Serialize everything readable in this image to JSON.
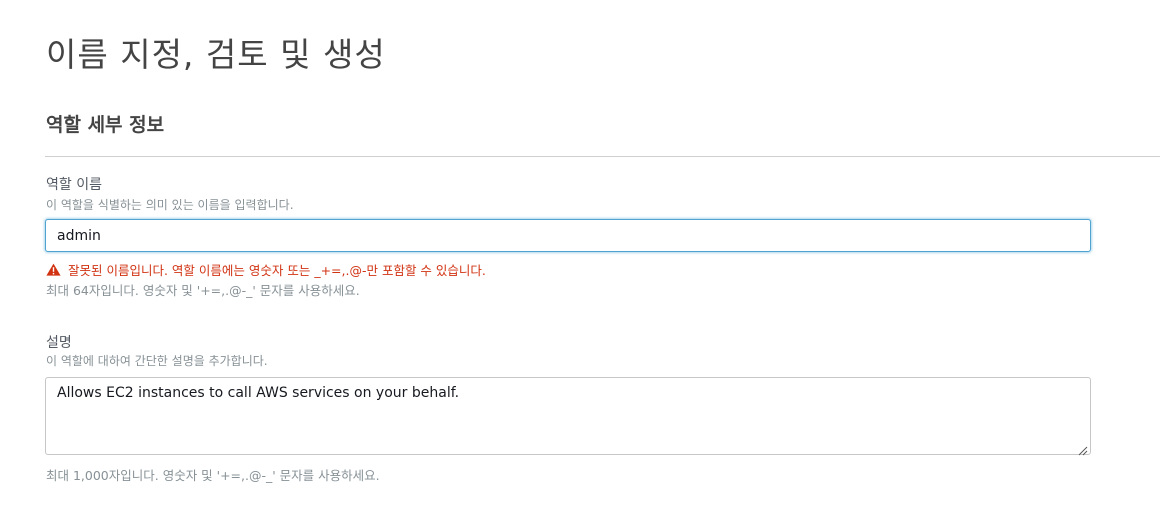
{
  "page": {
    "title": "이름 지정, 검토 및 생성"
  },
  "role_details": {
    "section_title": "역할 세부 정보",
    "name": {
      "label": "역할 이름",
      "description": "이 역할을 식별하는 의미 있는 이름을 입력합니다.",
      "value": "admin",
      "error": "잘못된 이름입니다. 역할 이름에는 영숫자 또는 _+=,.@-만 포함할 수 있습니다.",
      "hint": "최대 64자입니다. 영숫자 및 '+=,.@-_' 문자를 사용하세요."
    },
    "description": {
      "label": "설명",
      "description": "이 역할에 대하여 간단한 설명을 추가합니다.",
      "value": "Allows EC2 instances to call AWS services on your behalf.",
      "hint": "최대 1,000자입니다. 영숫자 및 '+=,.@-_' 문자를 사용하세요."
    }
  },
  "icons": {
    "error": "warning-triangle-icon",
    "resize": "resize-handle-icon"
  },
  "colors": {
    "error": "#d13212",
    "focus_border": "#4fa3d1",
    "hint": "#879196"
  }
}
